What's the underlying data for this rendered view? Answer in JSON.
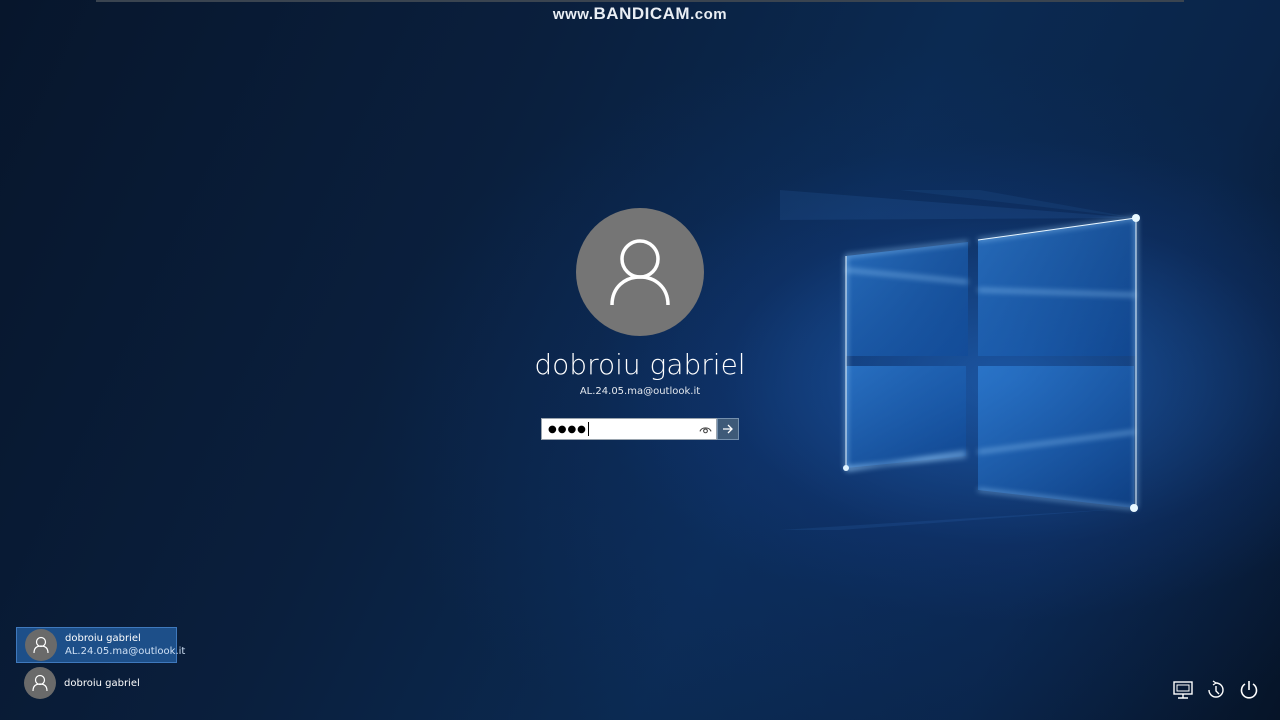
{
  "watermark": {
    "prefix": "www.",
    "brand": "BANDICAM",
    "suffix": ".com"
  },
  "login": {
    "display_name": "dobroiu gabriel",
    "email": "AL.24.05.ma@outlook.it",
    "password_masked": "●●●●",
    "avatar_icon": "user-icon",
    "reveal_icon": "eye-icon",
    "submit_icon": "arrow-right-icon"
  },
  "user_list": [
    {
      "name": "dobroiu gabriel",
      "email": "AL.24.05.ma@outlook.it",
      "selected": true
    },
    {
      "name": "dobroiu gabriel",
      "email": "",
      "selected": false
    }
  ],
  "system_icons": [
    "network-icon",
    "ease-of-access-icon",
    "power-icon"
  ],
  "colors": {
    "accent": "#1d4f89",
    "avatar": "#757575",
    "submit": "#3e5a78"
  }
}
